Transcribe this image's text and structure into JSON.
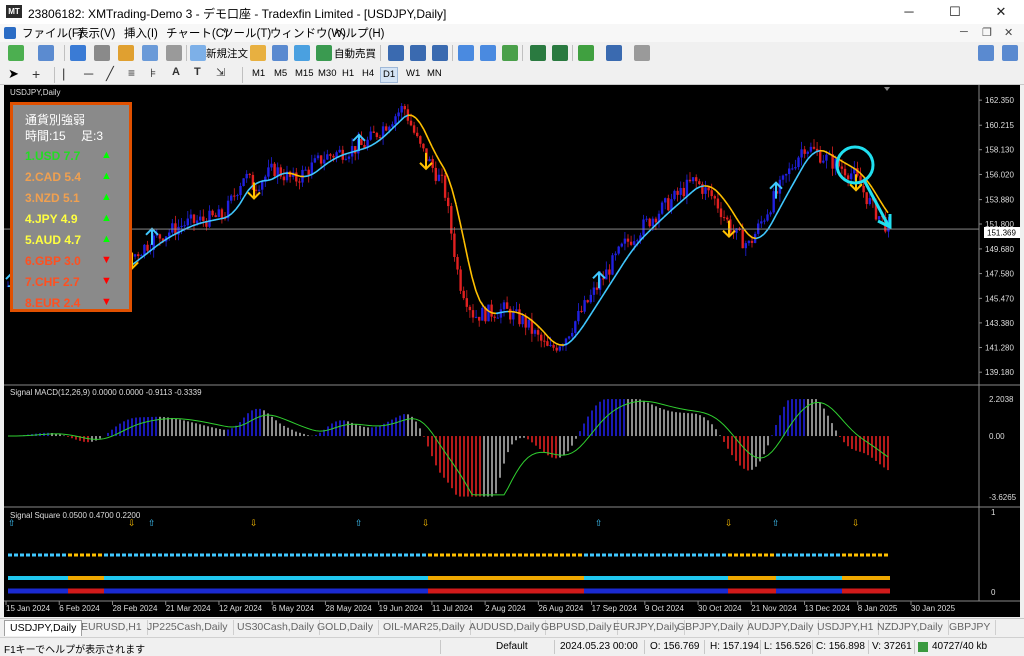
{
  "window": {
    "title": "23806182: XMTrading-Demo 3 - デモ口座 - Tradexfin Limited - [USDJPY,Daily]",
    "app_icon_text": "MT"
  },
  "menu": [
    "ファイル(F)",
    "表示(V)",
    "挿入(I)",
    "チャート(C)",
    "ツール(T)",
    "ウィンドウ(W)",
    "ヘルプ(H)"
  ],
  "toolbar": {
    "new_order": "新規注文",
    "auto_trading": "自動売買"
  },
  "timeframes": [
    "M1",
    "M5",
    "M15",
    "M30",
    "H1",
    "H4",
    "D1",
    "W1",
    "MN"
  ],
  "active_timeframe": "D1",
  "chart": {
    "symbol_label": "USDJPY,Daily",
    "current_price": "151.369",
    "price_ticks": [
      "162.350",
      "160.215",
      "158.130",
      "156.020",
      "153.880",
      "151.800",
      "149.680",
      "147.580",
      "145.470",
      "143.380",
      "141.280",
      "139.180"
    ],
    "date_ticks": [
      "15 Jan 2024",
      "6 Feb 2024",
      "28 Feb 2024",
      "21 Mar 2024",
      "12 Apr 2024",
      "6 May 2024",
      "28 May 2024",
      "19 Jun 2024",
      "11 Jul 2024",
      "2 Aug 2024",
      "26 Aug 2024",
      "17 Sep 2024",
      "9 Oct 2024",
      "30 Oct 2024",
      "21 Nov 2024",
      "13 Dec 2024",
      "8 Jan 2025",
      "30 Jan 2025"
    ],
    "macd_label": "Signal MACD(12,26,9) 0.0000 0.0000 -0.9113 -0.3339",
    "macd_ticks": [
      "2.2038",
      "0.00",
      "-3.6265"
    ],
    "square_label": "Signal Square 0.0500 0.4700 0.2200",
    "square_ticks": [
      "1",
      "0"
    ]
  },
  "strength": {
    "title": "通貨別強弱",
    "time_label": "時間:15",
    "bar_label": "足:3",
    "rows": [
      {
        "text": "1.USD 7.7",
        "color": "#22dd22",
        "dir": "▲",
        "dir_color": "#00ff00"
      },
      {
        "text": "2.CAD 5.4",
        "color": "#f0a050",
        "dir": "▲",
        "dir_color": "#00ff00"
      },
      {
        "text": "3.NZD 5.1",
        "color": "#f0a050",
        "dir": "▲",
        "dir_color": "#00ff00"
      },
      {
        "text": "4.JPY  4.9",
        "color": "#ffff40",
        "dir": "▲",
        "dir_color": "#00ff00"
      },
      {
        "text": "5.AUD 4.7",
        "color": "#ffff40",
        "dir": "▲",
        "dir_color": "#00ff00"
      },
      {
        "text": "6.GBP 3.0",
        "color": "#ff5020",
        "dir": "▼",
        "dir_color": "#ff0000"
      },
      {
        "text": "7.CHF 2.7",
        "color": "#ff5020",
        "dir": "▼",
        "dir_color": "#ff0000"
      },
      {
        "text": "8.EUR 2.4",
        "color": "#ff5020",
        "dir": "▼",
        "dir_color": "#ff0000"
      }
    ]
  },
  "tabs": [
    "USDJPY,Daily",
    "EURUSD,H1",
    "JP225Cash,Daily",
    "US30Cash,Daily",
    "GOLD,Daily",
    "OIL-MAR25,Daily",
    "AUDUSD,Daily",
    "GBPUSD,Daily",
    "EURJPY,Daily",
    "GBPJPY,Daily",
    "AUDJPY,Daily",
    "USDJPY,H1",
    "NZDJPY,Daily",
    "GBPJPY"
  ],
  "status": {
    "help": "F1キーでヘルプが表示されます",
    "profile": "Default",
    "datetime": "2024.05.23 00:00",
    "open": "O: 156.769",
    "high": "H: 157.194",
    "low": "L: 156.526",
    "close": "C: 156.898",
    "volume": "V: 37261",
    "traffic": "40727/40 kb"
  },
  "colors": {
    "bull": "#2020e0",
    "bear": "#e02020",
    "ma_up": "#40c8ff",
    "ma_down": "#ffc000",
    "accent": "#1a6fd0"
  }
}
